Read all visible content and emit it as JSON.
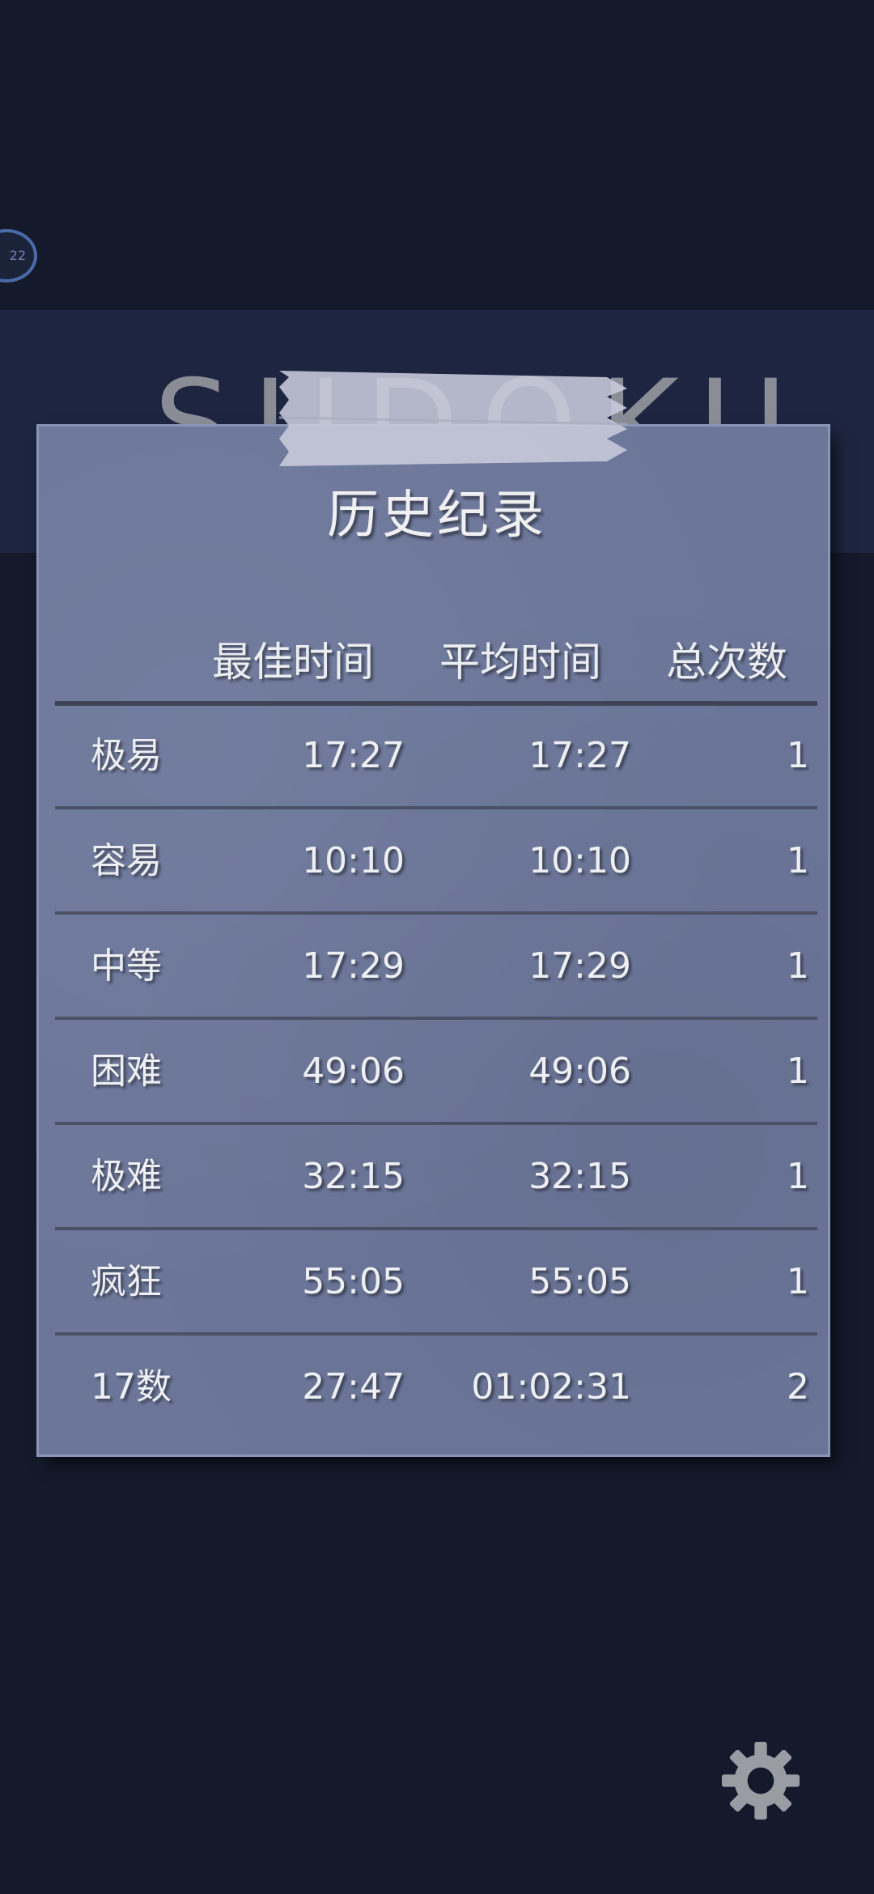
{
  "background_title": "SUDOKU",
  "level_badge": "22",
  "dialog": {
    "title": "历史纪录",
    "headers": {
      "best": "最佳时间",
      "average": "平均时间",
      "count": "总次数"
    },
    "rows": [
      {
        "name": "极易",
        "best": "17:27",
        "average": "17:27",
        "count": "1"
      },
      {
        "name": "容易",
        "best": "10:10",
        "average": "10:10",
        "count": "1"
      },
      {
        "name": "中等",
        "best": "17:29",
        "average": "17:29",
        "count": "1"
      },
      {
        "name": "困难",
        "best": "49:06",
        "average": "49:06",
        "count": "1"
      },
      {
        "name": "极难",
        "best": "32:15",
        "average": "32:15",
        "count": "1"
      },
      {
        "name": "疯狂",
        "best": "55:05",
        "average": "55:05",
        "count": "1"
      },
      {
        "name": "17数",
        "best": "27:47",
        "average": "01:02:31",
        "count": "2"
      }
    ]
  },
  "icons": {
    "settings": "gear-icon",
    "tape": "tape-strip"
  },
  "colors": {
    "background": "#141a2b",
    "header_band": "#1e2540",
    "paper": "#6b7699",
    "text": "#eeeff3"
  }
}
